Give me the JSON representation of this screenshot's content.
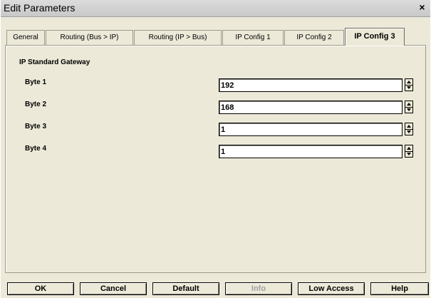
{
  "window": {
    "title": "Edit Parameters",
    "close_glyph": "×"
  },
  "tabs": [
    {
      "label": "General",
      "active": false
    },
    {
      "label": "Routing (Bus > IP)",
      "active": false
    },
    {
      "label": "Routing (IP > Bus)",
      "active": false
    },
    {
      "label": "IP Config 1",
      "active": false
    },
    {
      "label": "IP Config 2",
      "active": false
    },
    {
      "label": "IP Config 3",
      "active": true
    }
  ],
  "section": {
    "title": "IP Standard Gateway"
  },
  "fields": [
    {
      "label": "Byte 1",
      "value": "192"
    },
    {
      "label": "Byte 2",
      "value": "168"
    },
    {
      "label": "Byte 3",
      "value": "1"
    },
    {
      "label": "Byte 4",
      "value": "1"
    }
  ],
  "buttons": {
    "ok": "OK",
    "cancel": "Cancel",
    "default": "Default",
    "info": "Info",
    "low_access": "Low Access",
    "help": "Help"
  },
  "icons": {
    "spin_up": "spin-up-arrow-icon",
    "spin_down": "spin-down-arrow-icon",
    "close": "close-icon"
  }
}
